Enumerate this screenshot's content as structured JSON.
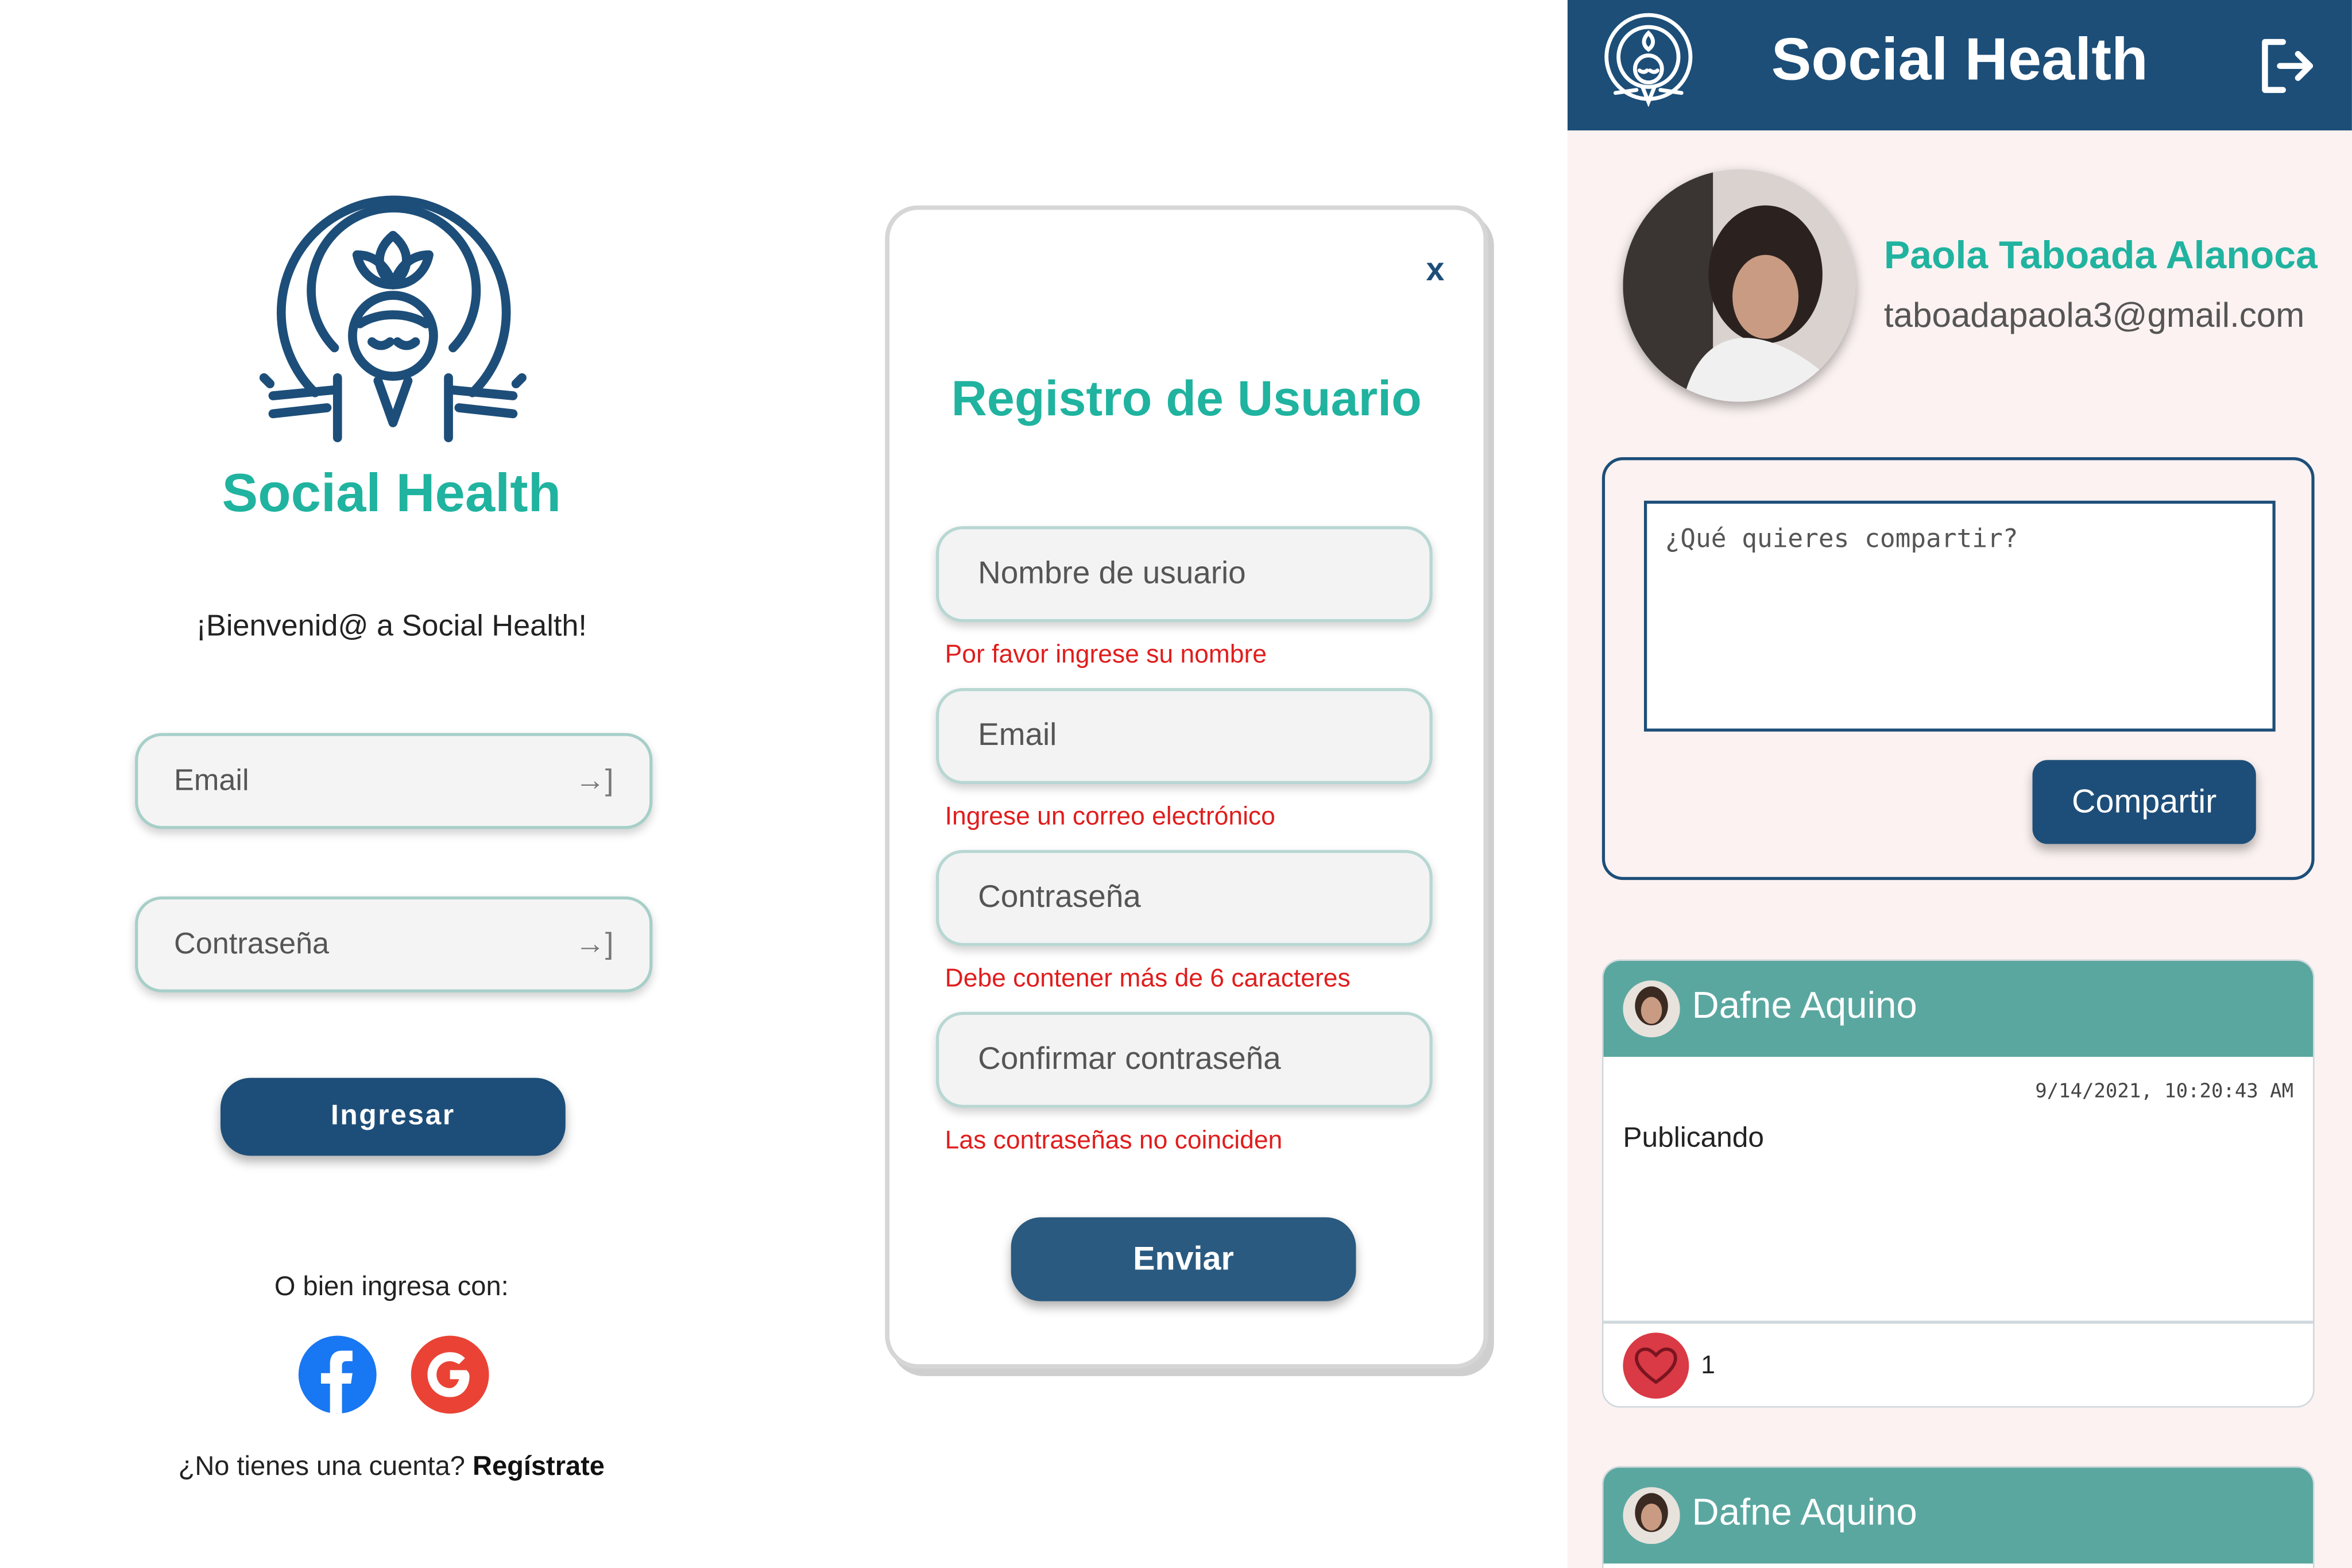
{
  "login": {
    "brand": "Social Health",
    "welcome": "¡Bienvenid@ a Social Health!",
    "email_placeholder": "Email",
    "password_placeholder": "Contraseña",
    "enter_icon": "→]",
    "login_button": "Ingresar",
    "alt_login": "O bien ingresa con:",
    "social_icons": [
      "facebook-icon",
      "google-icon"
    ],
    "no_account": "¿No tienes una cuenta?",
    "signup_link": "Regístrate"
  },
  "register": {
    "close": "x",
    "title": "Registro de Usuario",
    "fields": [
      {
        "placeholder": "Nombre de usuario",
        "error": "Por favor ingrese su nombre"
      },
      {
        "placeholder": "Email",
        "error": "Ingrese un correo electrónico"
      },
      {
        "placeholder": "Contraseña",
        "error": "Debe contener más de 6 caracteres"
      },
      {
        "placeholder": "Confirmar contraseña",
        "error": "Las contraseñas no coinciden"
      }
    ],
    "submit_button": "Enviar"
  },
  "feed": {
    "app_title": "Social Health",
    "profile": {
      "name": "Paola Taboada Alanoca",
      "email": "taboadapaola3@gmail.com"
    },
    "share": {
      "placeholder": "¿Qué quieres compartir?",
      "button": "Compartir"
    },
    "posts": [
      {
        "author": "Dafne Aquino",
        "timestamp": "9/14/2021, 10:20:43 AM",
        "content": "Publicando",
        "likes": "1"
      },
      {
        "author": "Dafne Aquino"
      }
    ]
  },
  "colors": {
    "primary": "#1d4e79",
    "accent": "#20b39f",
    "error": "#e01d1d",
    "post_header": "#5aa7a0",
    "feed_bg": "#fbf2f1",
    "like": "#d93a45",
    "facebook": "#1877f2",
    "google": "#ea4335"
  }
}
